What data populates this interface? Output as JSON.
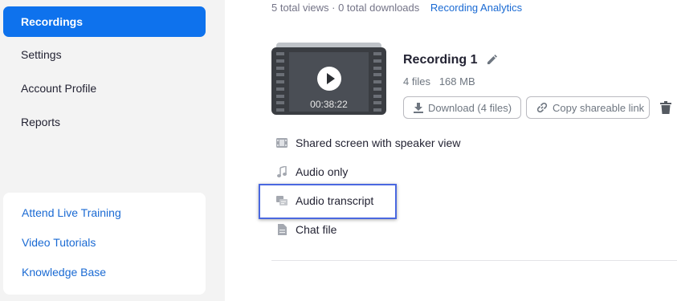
{
  "sidebar": {
    "items": [
      {
        "label": "Recordings",
        "active": true
      },
      {
        "label": "Settings",
        "active": false
      },
      {
        "label": "Account Profile",
        "active": false
      },
      {
        "label": "Reports",
        "active": false
      }
    ],
    "help_links": [
      "Attend Live Training",
      "Video Tutorials",
      "Knowledge Base"
    ]
  },
  "main": {
    "stats": "5 total views · 0 total downloads",
    "analytics_link": "Recording Analytics",
    "recording": {
      "duration": "00:38:22",
      "title": "Recording 1",
      "files_count": "4 files",
      "size": "168 MB",
      "download_label": "Download (4 files)",
      "copy_link_label": "Copy shareable link"
    },
    "files": [
      {
        "label": "Shared screen with speaker view",
        "icon": "video-file-icon"
      },
      {
        "label": "Audio only",
        "icon": "music-note-icon"
      },
      {
        "label": "Audio transcript",
        "icon": "transcript-icon"
      },
      {
        "label": "Chat file",
        "icon": "document-icon"
      }
    ]
  },
  "colors": {
    "accent": "#0e72ed",
    "link": "#1a6ad3",
    "highlight": "#4a68e0"
  }
}
